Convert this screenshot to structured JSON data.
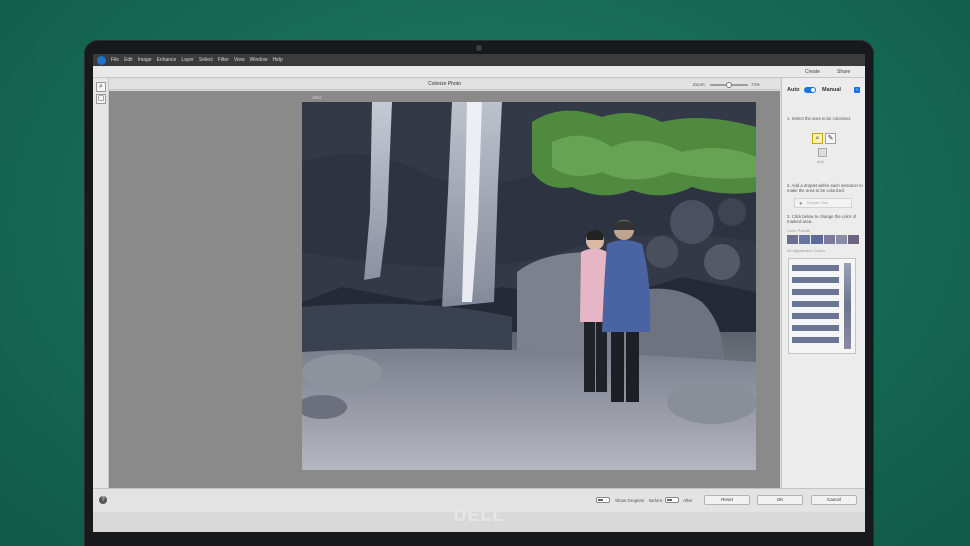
{
  "menubar": {
    "items": [
      "File",
      "Edit",
      "Image",
      "Enhance",
      "Layer",
      "Select",
      "Filter",
      "View",
      "Window",
      "Help"
    ]
  },
  "toolbar": {
    "create_label": "Create",
    "share_label": "Share"
  },
  "dialog": {
    "title": "Colorize Photo",
    "zoom_label": "Zoom:",
    "zoom_value": "74%",
    "after_label": "After"
  },
  "panel": {
    "auto_label": "Auto",
    "manual_label": "Manual",
    "step1": "1. Select the area to be colorized.",
    "add_label": "Add",
    "step2": "2. Add a droplet within each selection to make the area to be colorized.",
    "droplet_button": "Droplet Tool",
    "step3": "3. Click below to change the color of marked area.",
    "color_palette_label": "Color Palette",
    "adjustment_label": "All Adjustment Colors",
    "swatches": [
      "#6a6f8e",
      "#6a75a0",
      "#5a6a9a",
      "#7c7aa0",
      "#8a8ca6",
      "#6d6480"
    ]
  },
  "bottombar": {
    "show_droplets": "Show Droplets",
    "before": "Before",
    "after": "After",
    "reset": "Reset",
    "ok": "OK",
    "cancel": "Cancel"
  },
  "brand": {
    "logo": "DELL"
  }
}
